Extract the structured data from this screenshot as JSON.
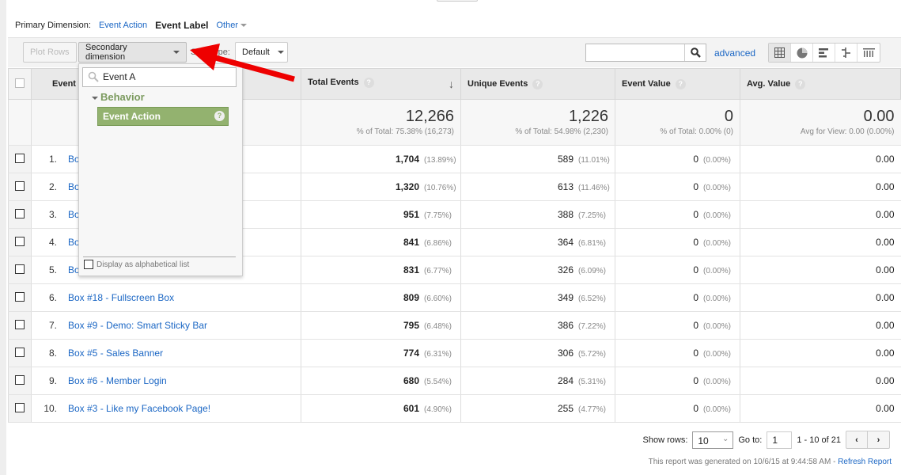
{
  "primary": {
    "label": "Primary Dimension:",
    "event_action": "Event Action",
    "event_label": "Event Label",
    "other": "Other"
  },
  "toolbar": {
    "plot_rows": "Plot Rows",
    "secondary_dimension": "Secondary dimension",
    "sort_type": "Sort Type:",
    "sort_value": "Default",
    "search_value": "",
    "advanced": "advanced"
  },
  "dropdown": {
    "search_value": "Event A",
    "group": "Behavior",
    "item": "Event Action",
    "alphabetical": "Display as alphabetical list"
  },
  "columns": {
    "event": "Event",
    "total": "Total Events",
    "unique": "Unique Events",
    "value": "Event Value",
    "avg": "Avg. Value"
  },
  "summary": {
    "total": "12,266",
    "total_sub": "% of Total: 75.38% (16,273)",
    "unique": "1,226",
    "unique_sub": "% of Total: 54.98% (2,230)",
    "value": "0",
    "value_sub": "% of Total: 0.00% (0)",
    "avg": "0.00",
    "avg_sub": "Avg for View: 0.00 (0.00%)"
  },
  "rows": [
    {
      "i": "1.",
      "label": "Box",
      "total": "1,704",
      "tp": "(13.89%)",
      "unique": "589",
      "up": "(11.01%)",
      "value": "0",
      "vp": "(0.00%)",
      "avg": "0.00"
    },
    {
      "i": "2.",
      "label": "Box",
      "total": "1,320",
      "tp": "(10.76%)",
      "unique": "613",
      "up": "(11.46%)",
      "value": "0",
      "vp": "(0.00%)",
      "avg": "0.00"
    },
    {
      "i": "3.",
      "label": "Box",
      "total": "951",
      "tp": "(7.75%)",
      "unique": "388",
      "up": "(7.25%)",
      "value": "0",
      "vp": "(0.00%)",
      "avg": "0.00"
    },
    {
      "i": "4.",
      "label": "Box",
      "total": "841",
      "tp": "(6.86%)",
      "unique": "364",
      "up": "(6.81%)",
      "value": "0",
      "vp": "(0.00%)",
      "avg": "0.00"
    },
    {
      "i": "5.",
      "label": "Box",
      "total": "831",
      "tp": "(6.77%)",
      "unique": "326",
      "up": "(6.09%)",
      "value": "0",
      "vp": "(0.00%)",
      "avg": "0.00"
    },
    {
      "i": "6.",
      "label": "Box #18 - Fullscreen Box",
      "total": "809",
      "tp": "(6.60%)",
      "unique": "349",
      "up": "(6.52%)",
      "value": "0",
      "vp": "(0.00%)",
      "avg": "0.00"
    },
    {
      "i": "7.",
      "label": "Box #9 - Demo: Smart Sticky Bar",
      "total": "795",
      "tp": "(6.48%)",
      "unique": "386",
      "up": "(7.22%)",
      "value": "0",
      "vp": "(0.00%)",
      "avg": "0.00"
    },
    {
      "i": "8.",
      "label": "Box #5 - Sales Banner",
      "total": "774",
      "tp": "(6.31%)",
      "unique": "306",
      "up": "(5.72%)",
      "value": "0",
      "vp": "(0.00%)",
      "avg": "0.00"
    },
    {
      "i": "9.",
      "label": "Box #6 - Member Login",
      "total": "680",
      "tp": "(5.54%)",
      "unique": "284",
      "up": "(5.31%)",
      "value": "0",
      "vp": "(0.00%)",
      "avg": "0.00"
    },
    {
      "i": "10.",
      "label": "Box #3 - Like my Facebook Page!",
      "total": "601",
      "tp": "(4.90%)",
      "unique": "255",
      "up": "(4.77%)",
      "value": "0",
      "vp": "(0.00%)",
      "avg": "0.00"
    }
  ],
  "footer": {
    "show_rows": "Show rows:",
    "rows_value": "10",
    "goto": "Go to:",
    "goto_value": "1",
    "range": "1 - 10 of 21",
    "generated": "This report was generated on 10/6/15 at 9:44:58 AM - ",
    "refresh": "Refresh Report"
  },
  "colors": {
    "link": "#1a66c4",
    "selected_item": "#93b26f",
    "annotation_arrow": "#ee0000"
  }
}
